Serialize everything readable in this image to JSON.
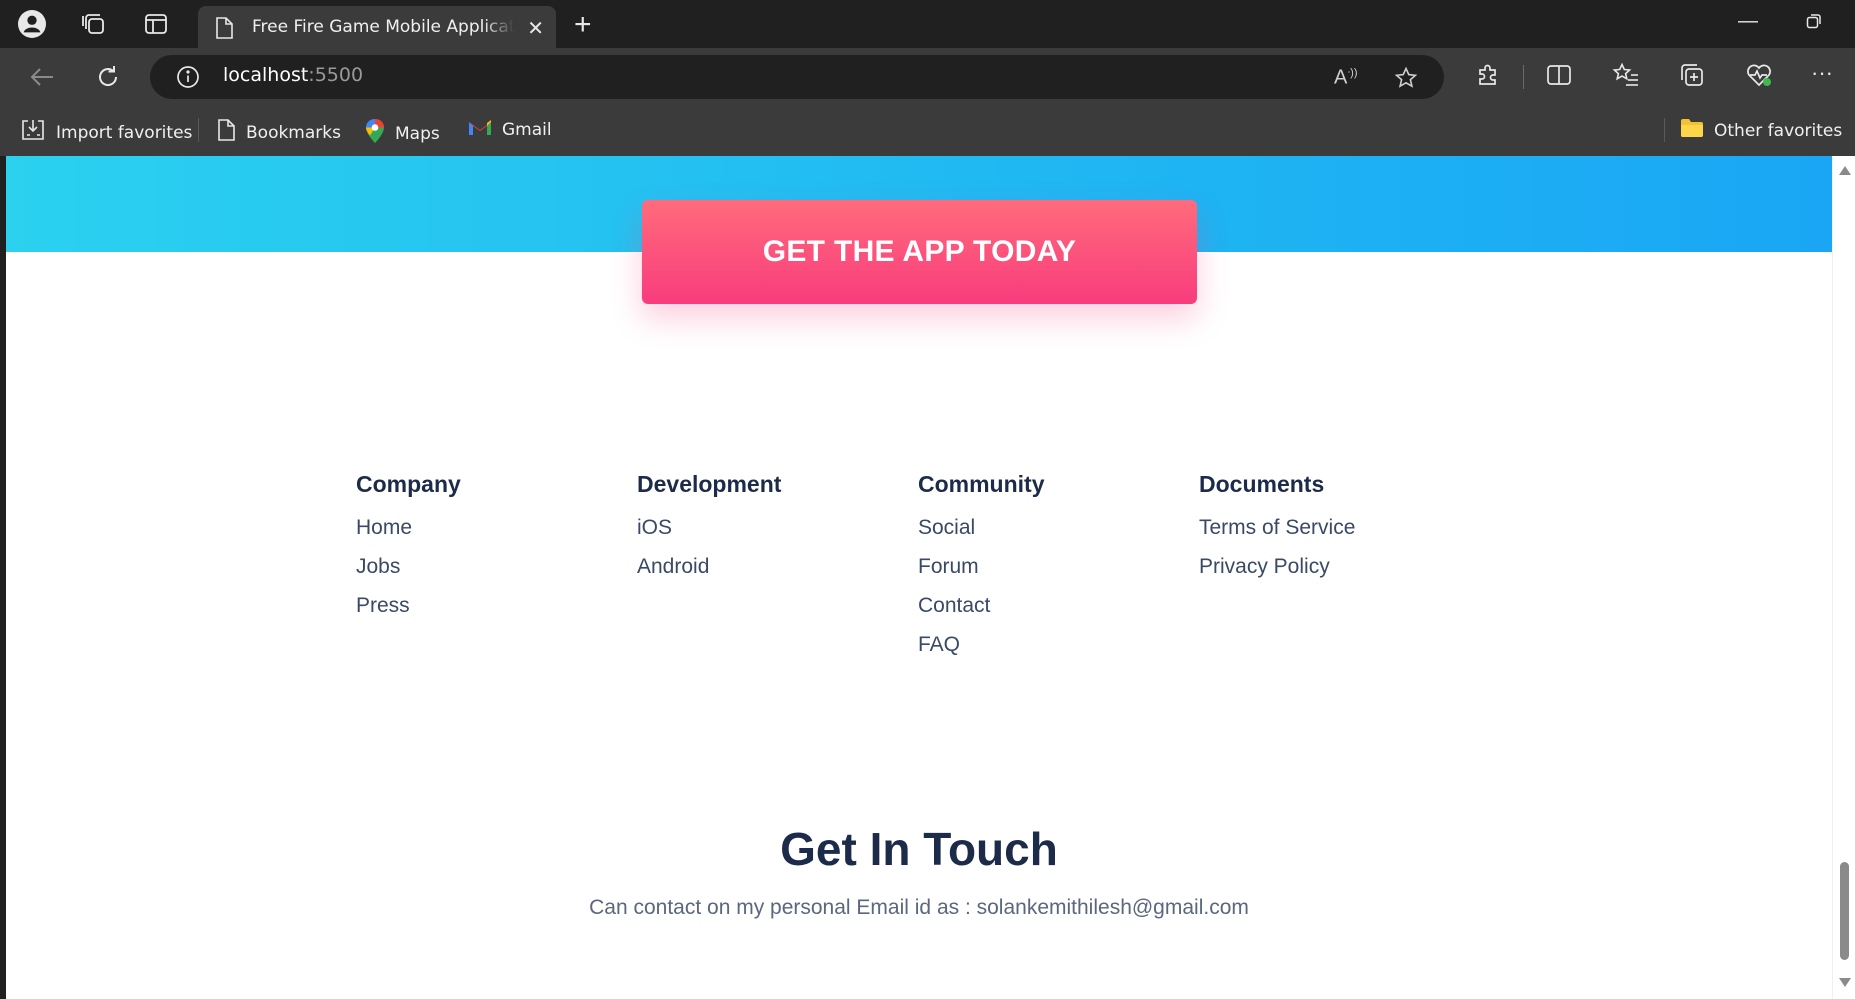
{
  "browser": {
    "tab_title": "Free Fire Game Mobile Application",
    "url_host": "localhost",
    "url_port": ":5500",
    "favorites": [
      {
        "label": "Import favorites",
        "icon": "import-favorites-icon"
      },
      {
        "label": "Bookmarks",
        "icon": "page-icon"
      },
      {
        "label": "Maps",
        "icon": "maps-pin-icon"
      },
      {
        "label": "Gmail",
        "icon": "gmail-icon"
      }
    ],
    "other_favorites": "Other favorites"
  },
  "page": {
    "cta_label": "GET THE APP TODAY",
    "footer_columns": [
      {
        "heading": "Company",
        "links": [
          "Home",
          "Jobs",
          "Press"
        ]
      },
      {
        "heading": "Development",
        "links": [
          "iOS",
          "Android"
        ]
      },
      {
        "heading": "Community",
        "links": [
          "Social",
          "Forum",
          "Contact",
          "FAQ"
        ]
      },
      {
        "heading": "Documents",
        "links": [
          "Terms of Service",
          "Privacy Policy"
        ]
      }
    ],
    "touch_title": "Get In Touch",
    "touch_text": "Can contact on my personal Email id as : solankemithilesh@gmail.com"
  },
  "colors": {
    "hero_gradient_start": "#2bd1ef",
    "hero_gradient_end": "#1aa6f4",
    "cta_top": "#ff6b7c",
    "cta_bottom": "#f83c7d",
    "heading": "#1d2b4a"
  }
}
